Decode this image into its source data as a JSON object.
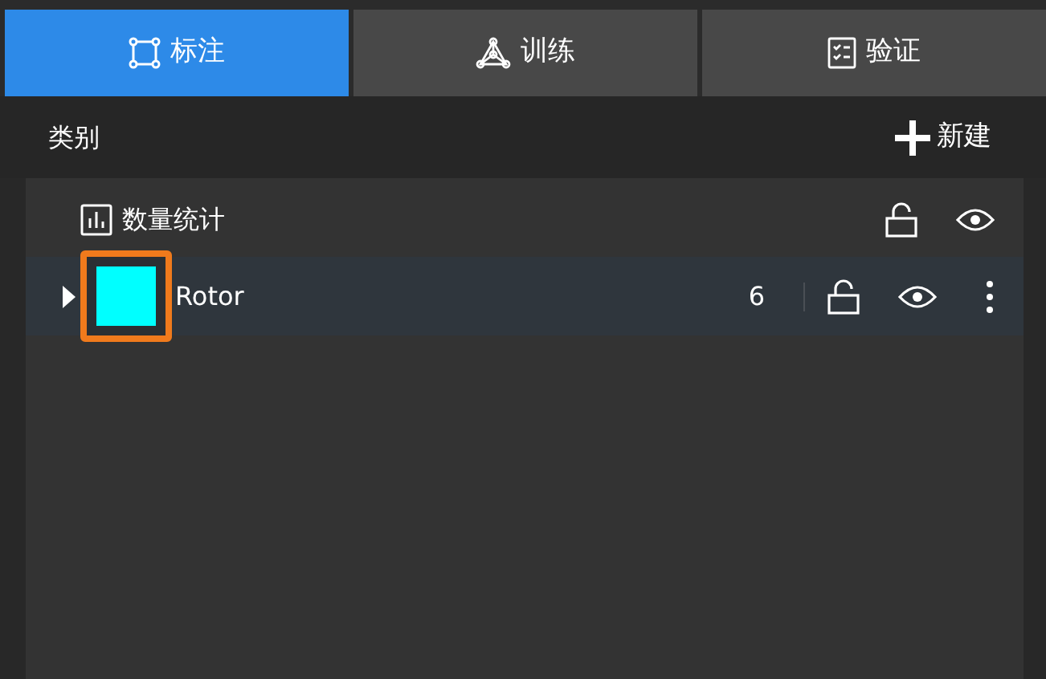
{
  "tabs": [
    {
      "label": "标注",
      "kind": "annotate",
      "selected": true
    },
    {
      "label": "训练",
      "kind": "train",
      "selected": false
    },
    {
      "label": "验证",
      "kind": "verify",
      "selected": false
    }
  ],
  "category_header": {
    "title": "类别",
    "new_button": "新建"
  },
  "statistics_row": {
    "label": "数量统计",
    "locked": false,
    "visible": true
  },
  "categories": [
    {
      "name": "Rotor",
      "count": "6",
      "color": "#00ffff",
      "expanded": false,
      "highlighted": true,
      "locked": false,
      "visible": true
    }
  ]
}
